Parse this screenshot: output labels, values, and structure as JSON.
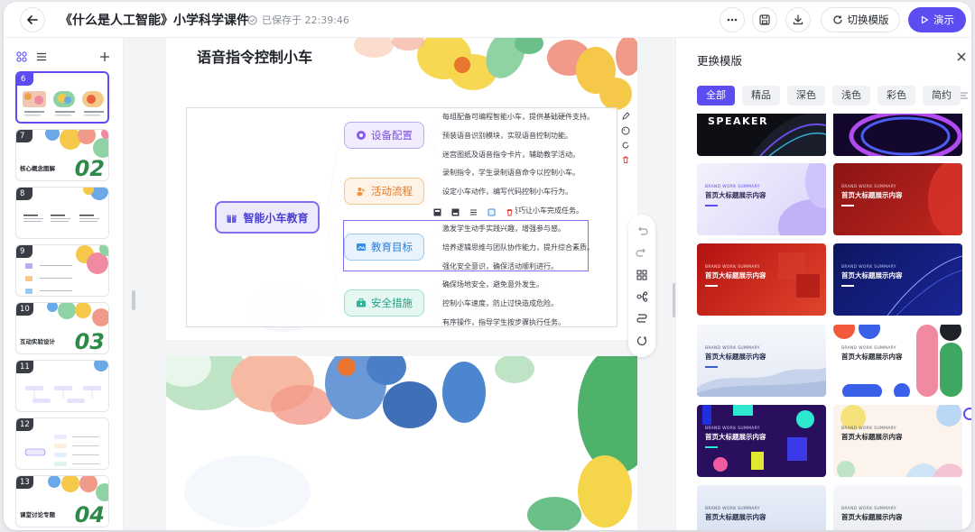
{
  "header": {
    "back_icon": "arrow-left-icon",
    "title": "《什么是人工智能》小学科学课件",
    "save_status": "已保存于 22:39:46",
    "more_icon": "more-horizontal-icon",
    "save_icon": "floppy-disk-icon",
    "download_icon": "download-icon",
    "switch_template_label": "切换模版",
    "present_label": "演示"
  },
  "sidebar": {
    "thumbnails": [
      {
        "number": "6",
        "label": ""
      },
      {
        "number": "7",
        "label": "核心概念图解",
        "big": "02"
      },
      {
        "number": "8",
        "label": ""
      },
      {
        "number": "9",
        "label": ""
      },
      {
        "number": "10",
        "label": "互动实验设计",
        "big": "03"
      },
      {
        "number": "11",
        "label": ""
      },
      {
        "number": "12",
        "label": ""
      },
      {
        "number": "13",
        "label": "课堂讨论专题",
        "big": "04"
      }
    ]
  },
  "slide": {
    "title": "语音指令控制小车",
    "root": "智能小车教育",
    "branches": [
      {
        "label": "设备配置",
        "leaves": [
          "每组配备可编程智能小车，提供基础硬件支持。",
          "预装语音识别模块，实现语音控制功能。",
          "迷宫图纸及语音指令卡片，辅助教学活动。"
        ]
      },
      {
        "label": "活动流程",
        "leaves": [
          "录制指令，学生录制语音命令以控制小车。",
          "设定小车动作，编写代码控制小车行为。",
          "…技巧让小车完成任务。"
        ]
      },
      {
        "label": "教育目标",
        "leaves": [
          "激发学生动手实践兴趣，增强参与感。",
          "培养逻辑思维与团队协作能力，提升综合素质。",
          "强化安全意识，确保活动顺利进行。"
        ]
      },
      {
        "label": "安全措施",
        "leaves": [
          "确保场地安全，避免意外发生。",
          "控制小车速度，防止过快造成危险。",
          "有序操作，指导学生按步骤执行任务。"
        ]
      }
    ]
  },
  "panel": {
    "title": "更换模版",
    "filters": [
      "全部",
      "精品",
      "深色",
      "浅色",
      "彩色",
      "简约"
    ],
    "active_filter": "全部",
    "speaker_text": "SPEAKER",
    "template_subtitle": "BRAND WORK SUMMARY",
    "template_main": "首页大标题展示内容"
  },
  "colors": {
    "accent": "#5b4df0",
    "branch_purple": "#8a5cf0",
    "branch_orange": "#f0903a",
    "branch_blue": "#3a8ee6",
    "branch_teal": "#2fb39a"
  }
}
